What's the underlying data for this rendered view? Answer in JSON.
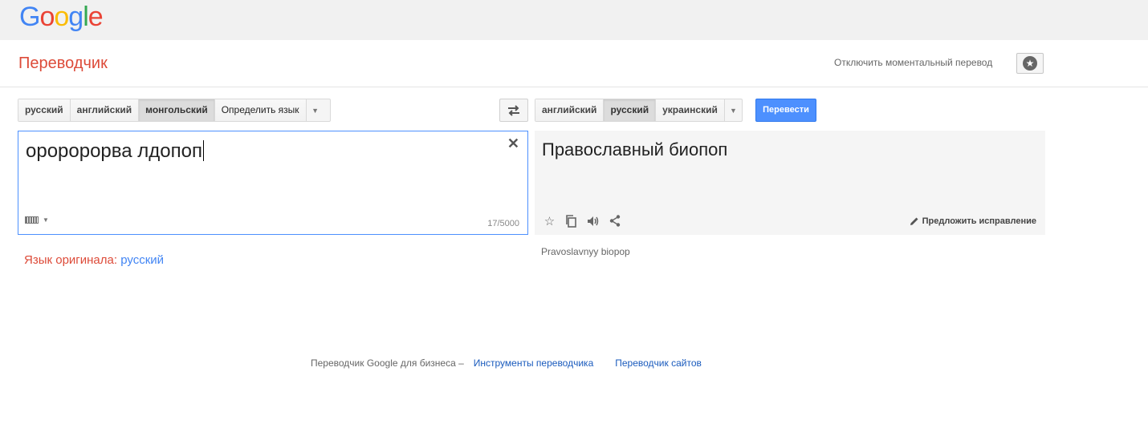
{
  "logo": {
    "letters": [
      "G",
      "o",
      "o",
      "g",
      "l",
      "e"
    ],
    "colors": [
      "#4285f4",
      "#ea4335",
      "#fbbc05",
      "#4285f4",
      "#34a853",
      "#ea4335"
    ]
  },
  "header": {
    "title": "Переводчик",
    "instant_toggle": "Отключить моментальный перевод",
    "star_icon": "star-icon"
  },
  "source_langs": {
    "items": [
      "русский",
      "английский",
      "монгольский"
    ],
    "active": "монгольский",
    "detect": "Определить язык"
  },
  "target_langs": {
    "items": [
      "английский",
      "русский",
      "украинский"
    ],
    "active": "русский"
  },
  "translate_button": "Перевести",
  "source": {
    "text": "ороророрва лдопоп",
    "char_count": "17/5000"
  },
  "target": {
    "text": "Православный биопоп",
    "suggest": "Предложить исправление",
    "transliteration": "Pravoslavnyy biopop"
  },
  "detected": {
    "label": "Язык оригинала:",
    "lang": "русский"
  },
  "footer": {
    "text": "Переводчик Google для бизнеса –",
    "link1": "Инструменты переводчика",
    "link2": "Переводчик сайтов"
  },
  "colors": {
    "accent": "#4d90fe",
    "title_red": "#dd4b39",
    "link_blue": "#1a5bbd"
  }
}
